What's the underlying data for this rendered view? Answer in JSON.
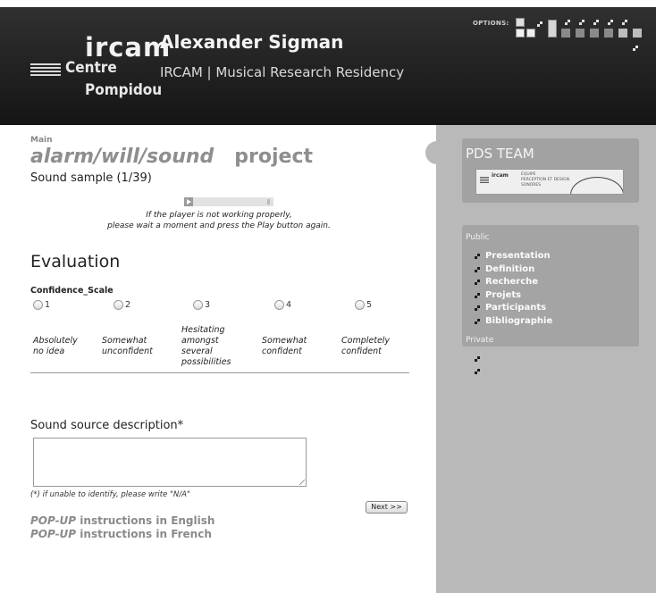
{
  "header": {
    "logo": {
      "line1": "ircam",
      "line2": "Centre",
      "line3": "Pompidou"
    },
    "title": "Alexander Sigman",
    "subtitle": "IRCAM | Musical Research Residency",
    "options_label": "OPTIONS:"
  },
  "main": {
    "breadcrumb": "Main",
    "project_name": "alarm/will/sound",
    "project_word": "project",
    "sample_label": "Sound sample (1/39)",
    "player_note_line1": "If the player is not working properly,",
    "player_note_line2": "please wait a moment and press the Play button again.",
    "evaluation_heading": "Evaluation",
    "scale_title": "Confidence_Scale",
    "scale_options": [
      "1",
      "2",
      "3",
      "4",
      "5"
    ],
    "scale_labels": [
      "Absolutely\nno idea",
      "Somewhat\nunconfident",
      "Hesitating\namongst\nseveral\npossibilities",
      "Somewhat\nconfident",
      "Completely\nconfident"
    ],
    "source_heading": "Sound source description*",
    "source_value": "",
    "source_note": "(*) if unable to identify, please write \"N/A\"",
    "next_label": "Next >>",
    "popup_en_prefix": "POP-UP",
    "popup_en_rest": " instructions in English",
    "popup_fr_prefix": "POP-UP",
    "popup_fr_rest": " instructions in French"
  },
  "sidebar": {
    "team_title": "PDS TEAM",
    "team_logo": {
      "ircam": "ircam",
      "line1": "ÉQUIPE",
      "line2": "PERCEPTION ET DESIGN",
      "line3": "SONORES"
    },
    "public_label": "Public",
    "public_links": [
      "Presentation",
      "Definition",
      "Recherche",
      "Projets",
      "Participants",
      "Bibliographie"
    ],
    "private_label": "Private"
  }
}
